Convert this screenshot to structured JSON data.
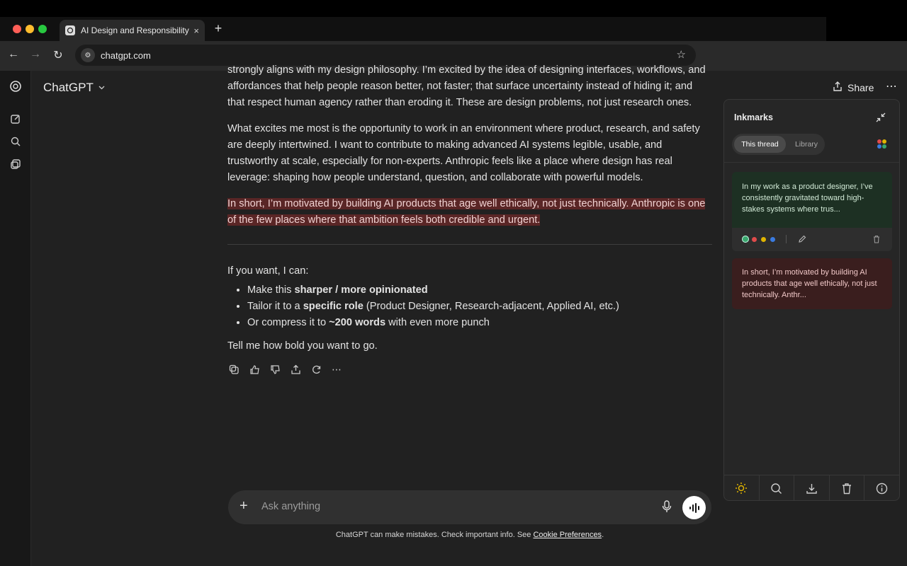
{
  "browser": {
    "tab_title": "AI Design and Responsibility",
    "tab_close": "×",
    "new_tab": "+",
    "url": "chatgpt.com"
  },
  "app": {
    "brand": "ChatGPT",
    "share_label": "Share"
  },
  "conversation": {
    "partial_top": "strongly aligns with my design philosophy. I’m excited by the idea of designing interfaces, workflows, and",
    "para1": "affordances that help people reason better, not faster; that surface uncertainty instead of hiding it; and that respect human agency rather than eroding it. These are design problems, not just research ones.",
    "para2": "What excites me most is the opportunity to work in an environment where product, research, and safety are deeply intertwined. I want to contribute to making advanced AI systems legible, usable, and trustworthy at scale, especially for non-experts. Anthropic feels like a place where design has real leverage: shaping how people understand, question, and collaborate with powerful models.",
    "para3_highlighted": "In short, I’m motivated by building AI products that age well ethically, not just technically. Anthropic is one of the few places where that ambition feels both credible and urgent.",
    "followup_intro": "If you want, I can:",
    "bullets": [
      {
        "pre": "Make this ",
        "bold": "sharper / more opinionated",
        "post": ""
      },
      {
        "pre": "Tailor it to a ",
        "bold": "specific role",
        "post": " (Product Designer, Research-adjacent, Applied AI, etc.)"
      },
      {
        "pre": "Or compress it to ",
        "bold": "~200 words",
        "post": " with even more punch"
      }
    ],
    "closing": "Tell me how bold you want to go."
  },
  "composer": {
    "placeholder": "Ask anything",
    "plus": "+"
  },
  "disclaimer": {
    "text": "ChatGPT can make mistakes. Check important info. See ",
    "link": "Cookie Preferences",
    "end": "."
  },
  "panel": {
    "title": "Inkmarks",
    "tabs": [
      "This thread",
      "Library"
    ],
    "cards": [
      {
        "text": "In my work as a product designer, I’ve consistently gravitated toward high-stakes systems where trus...",
        "color": "#1d3023"
      },
      {
        "text": "In short, I’m motivated by building AI products that age well ethically, not just technically. Anthr...",
        "color": "#3a1e1e"
      }
    ],
    "color_options": [
      "#3aa76d",
      "#e04b4b",
      "#e0b400",
      "#3a7be0"
    ]
  },
  "colors": {
    "highlight": "#5a2626",
    "accent_sun": "#e0b400"
  }
}
